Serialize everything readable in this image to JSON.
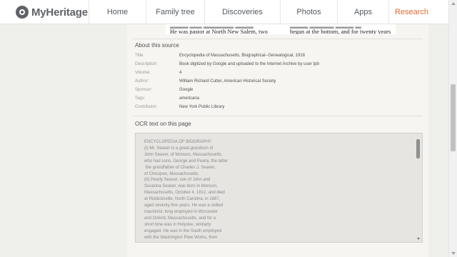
{
  "header": {
    "logo_text": "MyHeritage",
    "nav": [
      {
        "label": "Home",
        "active": false
      },
      {
        "label": "Family tree",
        "active": false
      },
      {
        "label": "Discoveries",
        "active": false
      },
      {
        "label": "Photos",
        "active": false
      },
      {
        "label": "Apps",
        "active": false
      },
      {
        "label": "Research",
        "active": true
      }
    ],
    "accent_color": "#e06a2c"
  },
  "document": {
    "line_a1": "He was pastor at North New Salem, two",
    "line_b1": "began at the bottom, and for twenty years"
  },
  "about": {
    "title": "About this source",
    "rows": [
      {
        "key": "Title:",
        "value": "Encyclopedia of Massachusetts, Biographical--Genealogical, 1916"
      },
      {
        "key": "Description:",
        "value": "Book digitized by Google and uploaded to the Internet Archive by user tpb"
      },
      {
        "key": "Volume:",
        "value": "4"
      },
      {
        "key": "Author:",
        "value": "William Richard Cutter, American Historical Society"
      },
      {
        "key": "Sponsor:",
        "value": "Google"
      },
      {
        "key": "Tags:",
        "value": "americana"
      },
      {
        "key": "Contributor:",
        "value": "New York Public Library"
      }
    ]
  },
  "ocr": {
    "title": "OCR text on this page",
    "text": "ENCYCLOPEDIA OF BIOGRAPHY\n(I) Mr. Seaver is a great-grandson of\nJohn Seaver, of Monson, Massachusetts,\nwho had sons, George and Pearly, the latter\n the grandfather of Charles J. Seaver,\nof Chicopee, Massachusetts.\n(II) Pearly Seaver, son of John and\nSusanna Seaver, was born in Monson,\nMassachusetts, October 4, 1812, and died\nat Riddicksville, North Carolina, in 1887,\naged seventy-five years. He was a skilled\nmachinist, long employed in Worcester\nand Oxford, Massachusetts, and for a\nshort time was in Holyoke, similarly\nengaged. He was in the South employed\nwith the Washington Plow Works, then\nwas a farmer of the State of Indiana, for\na time, returning thence to Worcester,\nMassachusetts, where he remained until"
  }
}
